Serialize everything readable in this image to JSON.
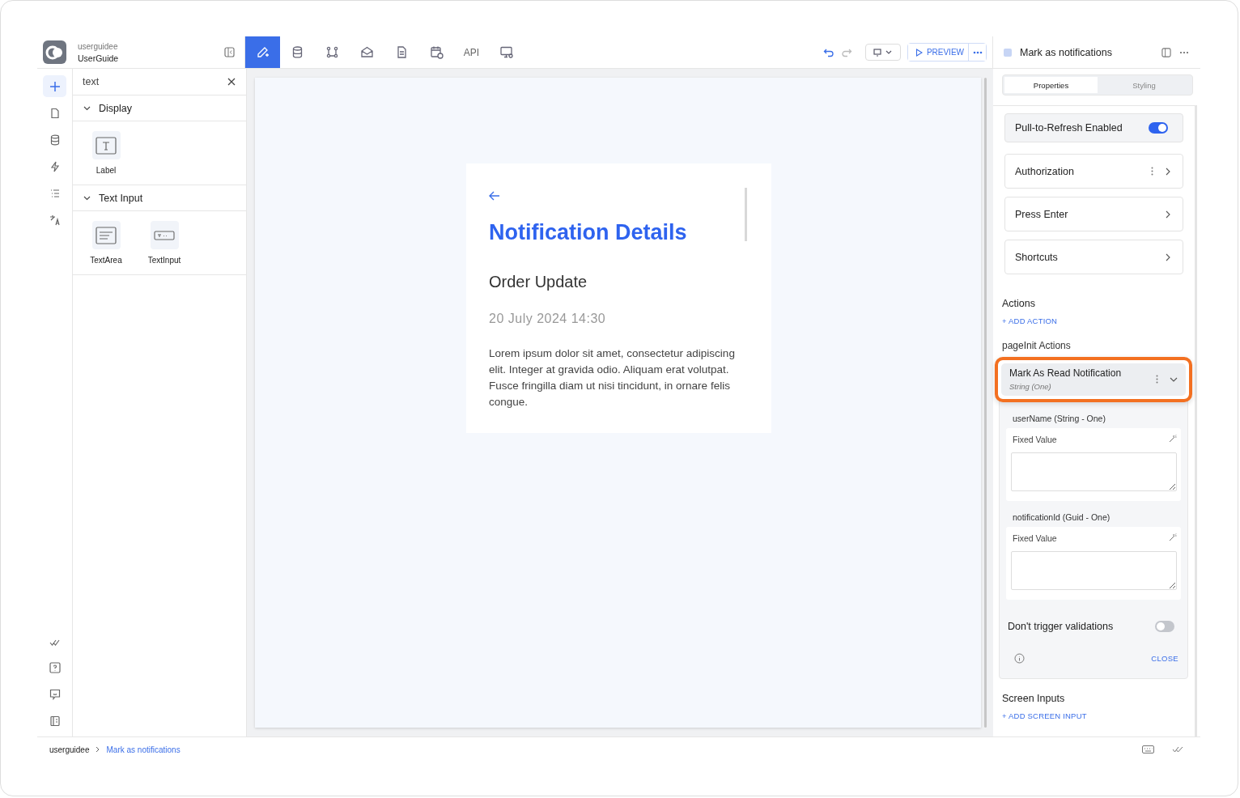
{
  "app": {
    "workspace": "userguidee",
    "project": "UserGuide"
  },
  "rail": [
    {
      "selected": true
    },
    {
      "selected": false
    },
    {
      "selected": false
    },
    {
      "selected": false
    },
    {
      "selected": false
    },
    {
      "selected": false
    }
  ],
  "search": {
    "value": "text"
  },
  "groups": [
    {
      "title": "Display",
      "expanded": true,
      "items": [
        {
          "label": "Label"
        }
      ]
    },
    {
      "title": "Text Input",
      "expanded": true,
      "items": [
        {
          "label": "TextArea"
        },
        {
          "label": "TextInput"
        }
      ]
    }
  ],
  "toolbar": [
    {
      "selected": true
    },
    {
      "selected": false
    },
    {
      "selected": false
    },
    {
      "selected": false
    },
    {
      "selected": false
    },
    {
      "selected": false
    },
    {
      "label": "API",
      "selected": false
    },
    {
      "selected": false
    }
  ],
  "preview_button": "PREVIEW",
  "screen": {
    "title": "Notification Details",
    "subtitle": "Order Update",
    "date": "20 July 2024 14:30",
    "body": "Lorem ipsum dolor sit amet, consectetur adipiscing elit. Integer at gravida odio. Aliquam erat volutpat. Fusce fringilla diam ut nisi tincidunt, in ornare felis congue."
  },
  "panel": {
    "title": "Mark as notifications",
    "tabs": [
      {
        "label": "Properties",
        "selected": true
      },
      {
        "label": "Styling",
        "selected": false
      }
    ],
    "settings": [
      {
        "kind": "toggle",
        "label": "Pull-to-Refresh Enabled",
        "on": true
      },
      {
        "kind": "nav",
        "label": "Authorization",
        "menu": true
      },
      {
        "kind": "nav",
        "label": "Press Enter",
        "menu": false
      },
      {
        "kind": "nav",
        "label": "Shortcuts",
        "menu": false
      }
    ],
    "actions_heading": "Actions",
    "add_action": "+ ADD ACTION",
    "section": "pageInit Actions",
    "action": {
      "name": "Mark As Read Notification",
      "type": "String (One)",
      "highlighted": true,
      "expanded": true,
      "params": [
        {
          "label": "userName (String - One)",
          "source": "Fixed Value"
        },
        {
          "label": "notificationId (Guid - One)",
          "source": "Fixed Value"
        }
      ],
      "validation": {
        "label": "Don't trigger validations",
        "on": false
      },
      "close": "CLOSE"
    },
    "inputs_heading": "Screen Inputs",
    "add_input": "+ ADD SCREEN INPUT"
  },
  "breadcrumb": [
    {
      "label": "userguidee",
      "selected": false
    },
    {
      "label": "Mark as notifications",
      "selected": true
    }
  ]
}
